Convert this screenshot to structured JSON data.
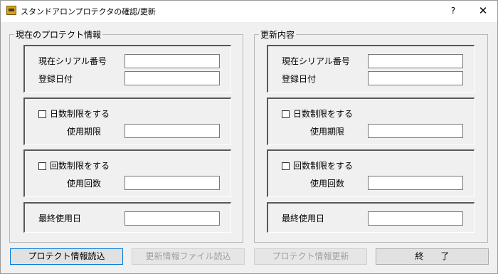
{
  "window": {
    "title": "スタンドアロンプロテクタの確認/更新",
    "help_glyph": "?",
    "close_glyph": "✕"
  },
  "current": {
    "group_title": "現在のプロテクト情報",
    "serial_label": "現在シリアル番号",
    "serial_value": "",
    "registered_label": "登録日付",
    "registered_value": "",
    "day_limit_label": "日数制限をする",
    "day_limit_checked": false,
    "expiry_label": "使用期限",
    "expiry_value": "",
    "count_limit_label": "回数制限をする",
    "count_limit_checked": false,
    "count_label": "使用回数",
    "count_value": "",
    "last_used_label": "最終使用日",
    "last_used_value": ""
  },
  "update": {
    "group_title": "更新内容",
    "serial_label": "現在シリアル番号",
    "serial_value": "",
    "registered_label": "登録日付",
    "registered_value": "",
    "day_limit_label": "日数制限をする",
    "day_limit_checked": false,
    "expiry_label": "使用期限",
    "expiry_value": "",
    "count_limit_label": "回数制限をする",
    "count_limit_checked": false,
    "count_label": "使用回数",
    "count_value": "",
    "last_used_label": "最終使用日",
    "last_used_value": ""
  },
  "buttons": {
    "read_protect": "プロテクト情報読込",
    "read_update_file": "更新情報ファイル読込",
    "update_protect": "プロテクト情報更新",
    "exit": "終　　了"
  }
}
